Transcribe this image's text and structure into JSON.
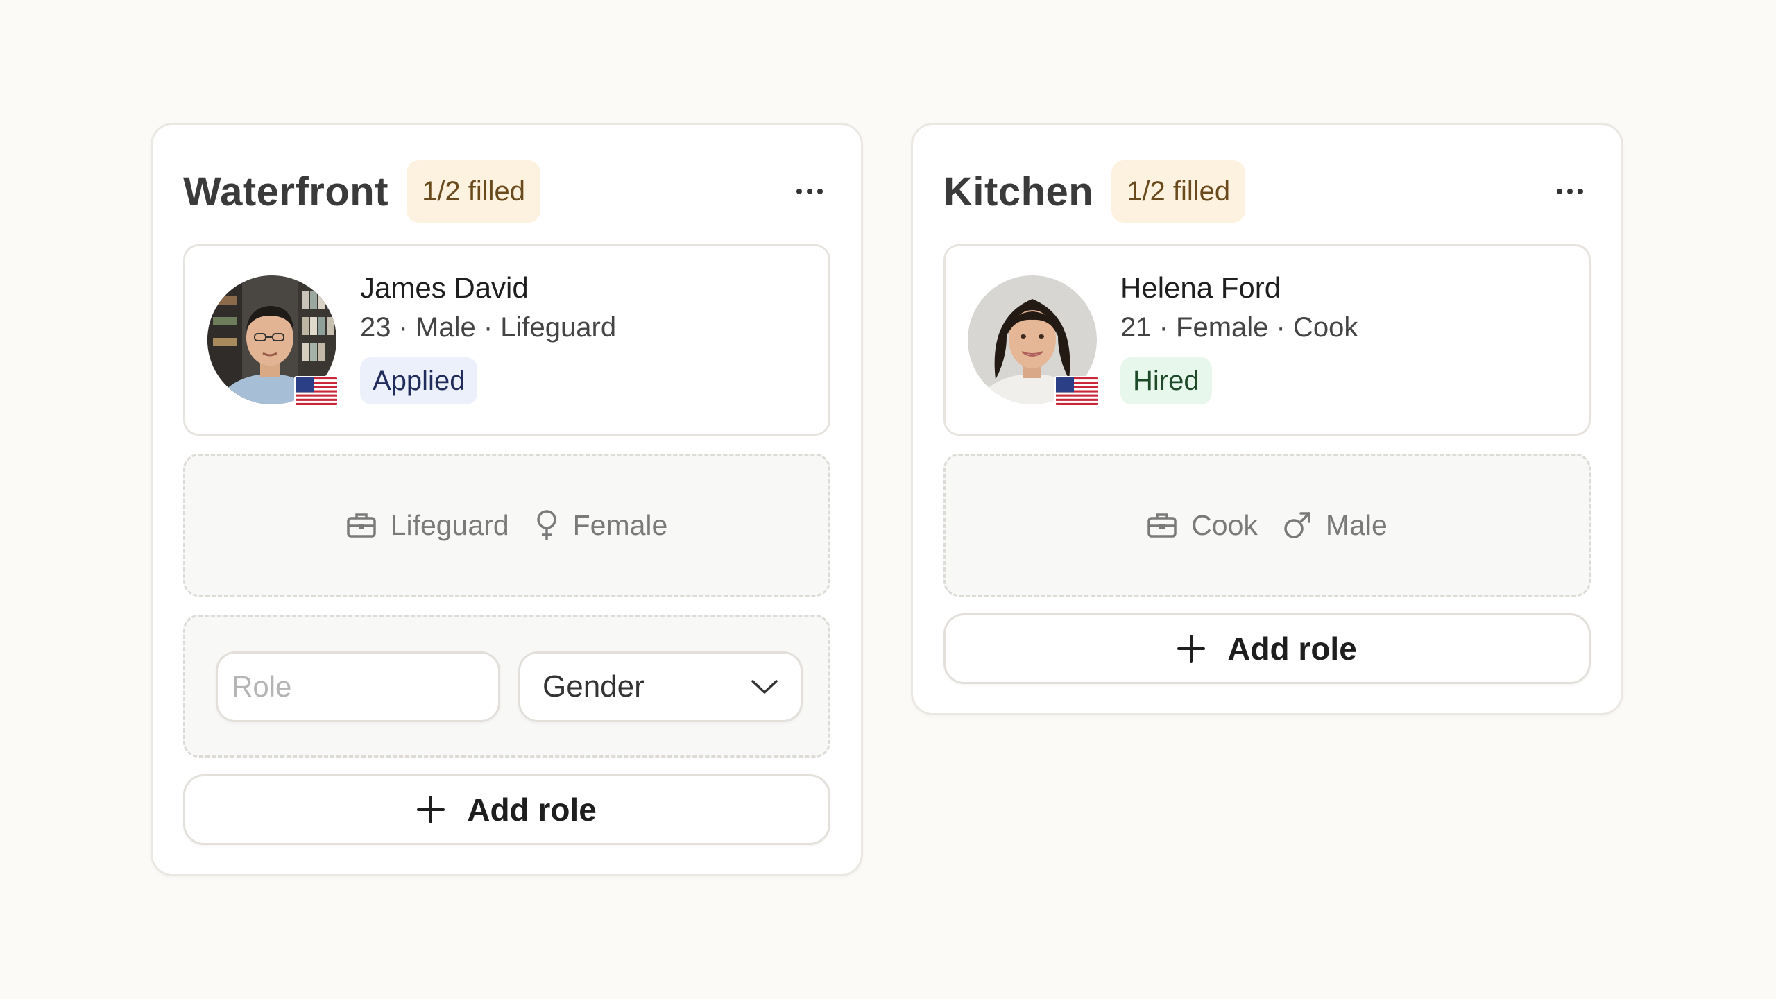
{
  "colors": {
    "background": "#fcfaf6",
    "filled_badge_bg": "#fdf1df",
    "applied_bg": "#ecf0fb",
    "hired_bg": "#e8f7ec"
  },
  "panels": [
    {
      "title": "Waterfront",
      "filled_label": "1/2 filled",
      "filled_count": 1,
      "total_count": 2,
      "more_icon": "more-horizontal-icon",
      "candidate": {
        "name": "James David",
        "meta": "23 · Male · Lifeguard",
        "status": "Applied",
        "flag_icon": "us-flag-icon"
      },
      "open_slot": {
        "role": "Lifeguard",
        "role_icon": "briefcase-icon",
        "gender": "Female",
        "gender_icon": "female-symbol-icon"
      },
      "new_slot": {
        "role_placeholder": "Role",
        "gender_value": "Gender",
        "gender_icon": "chevron-down-icon"
      },
      "add_role_label": "Add role",
      "add_icon": "plus-icon"
    },
    {
      "title": "Kitchen",
      "filled_label": "1/2 filled",
      "filled_count": 1,
      "total_count": 2,
      "more_icon": "more-horizontal-icon",
      "candidate": {
        "name": "Helena Ford",
        "meta": "21 · Female · Cook",
        "status": "Hired",
        "flag_icon": "us-flag-icon"
      },
      "open_slot": {
        "role": "Cook",
        "role_icon": "briefcase-icon",
        "gender": "Male",
        "gender_icon": "male-symbol-icon"
      },
      "add_role_label": "Add role",
      "add_icon": "plus-icon"
    }
  ]
}
